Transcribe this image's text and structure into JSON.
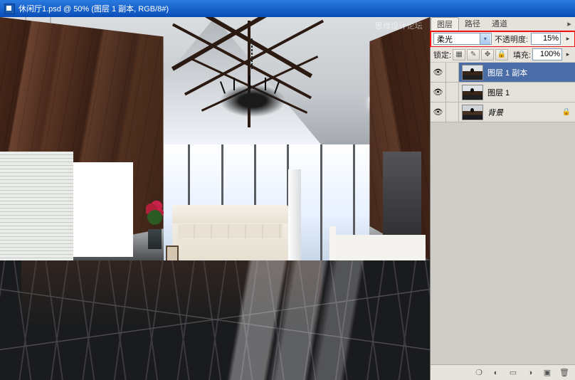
{
  "title": "休闲厅1.psd @ 50% (图层 1 副本, RGB/8#)",
  "watermark": "思缘设计论坛",
  "panel": {
    "tabs": {
      "layers": "图层",
      "paths": "路径",
      "channels": "通道"
    },
    "blend": {
      "mode_label": "柔光",
      "opacity_label": "不透明度:",
      "opacity_value": "15%"
    },
    "lock": {
      "label": "锁定:",
      "fill_label": "填充:",
      "fill_value": "100%"
    },
    "layers": [
      {
        "name": "图层 1 副本",
        "selected": true,
        "style": "normal"
      },
      {
        "name": "图层 1",
        "selected": false,
        "style": "normal"
      },
      {
        "name": "背景",
        "selected": false,
        "style": "italic",
        "locked": true
      }
    ],
    "eye_glyph": "👁",
    "lock_icons": {
      "trans": "▦",
      "pixel": "✎",
      "pos": "✥",
      "all": "🔒"
    },
    "footer_icons": {
      "fx": "❍",
      "mask": "◐",
      "folder": "▭",
      "adjust": "◑",
      "new": "▣",
      "trash": "🗑"
    }
  }
}
